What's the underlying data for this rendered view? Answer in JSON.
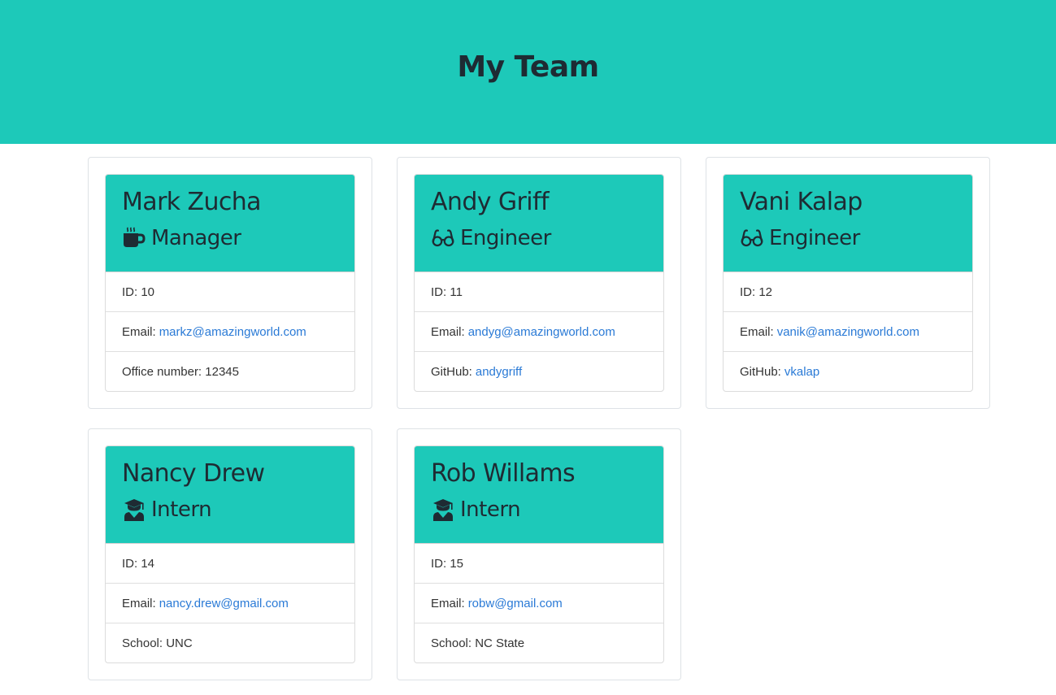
{
  "header": {
    "title": "My Team"
  },
  "team": [
    {
      "name": "Mark Zucha",
      "role": "Manager",
      "role_icon": "coffee-mug-icon",
      "id_label": "ID: 10",
      "email_label": "Email:",
      "email": "markz@amazingworld.com",
      "extra_label": "Office number: 12345",
      "extra_link": ""
    },
    {
      "name": "Andy Griff",
      "role": "Engineer",
      "role_icon": "glasses-icon",
      "id_label": "ID: 11",
      "email_label": "Email:",
      "email": "andyg@amazingworld.com",
      "extra_label": "GitHub:",
      "extra_link": "andygriff"
    },
    {
      "name": "Vani Kalap",
      "role": "Engineer",
      "role_icon": "glasses-icon",
      "id_label": "ID: 12",
      "email_label": "Email:",
      "email": "vanik@amazingworld.com",
      "extra_label": "GitHub:",
      "extra_link": "vkalap"
    },
    {
      "name": "Nancy Drew",
      "role": "Intern",
      "role_icon": "graduate-icon",
      "id_label": "ID: 14",
      "email_label": "Email:",
      "email": "nancy.drew@gmail.com",
      "extra_label": "School: UNC",
      "extra_link": ""
    },
    {
      "name": "Rob Willams",
      "role": "Intern",
      "role_icon": "graduate-icon",
      "id_label": "ID: 15",
      "email_label": "Email:",
      "email": "robw@gmail.com",
      "extra_label": "School: NC State",
      "extra_link": ""
    }
  ],
  "colors": {
    "accent": "#1dc9b9",
    "link": "#2a7ad6",
    "text": "#1e2b33"
  }
}
